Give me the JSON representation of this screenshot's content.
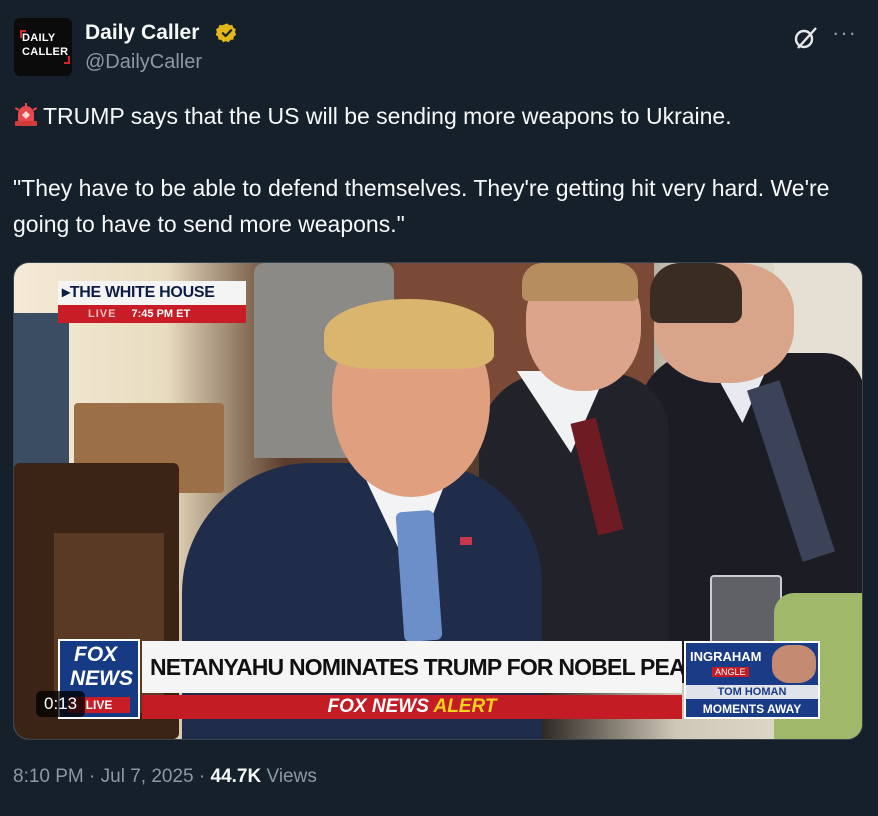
{
  "account": {
    "avatar_text_line1": "DAILY",
    "avatar_text_line2": "CALLER",
    "name": "Daily Caller",
    "handle": "@DailyCaller",
    "verified_icon": "gold-verified-badge-icon",
    "verified_color": "#e2b719"
  },
  "header_icons": [
    "grok-icon",
    "more-options-icon"
  ],
  "more_label": "···",
  "post": {
    "line1_emoji": "police-siren-icon",
    "line1": "TRUMP says that the US will be sending more weapons to Ukraine.",
    "line2": "\"They have to be able to defend themselves. They're getting hit very hard. We're going to have to send more weapons.\""
  },
  "video": {
    "location_badge": "THE WHITE HOUSE",
    "live_label": "LIVE",
    "time_label": "7:45 PM ET",
    "network_logo_line1": "FOX",
    "network_logo_line2": "NEWS",
    "network_logo_live": "LIVE",
    "headline": "NETANYAHU NOMINATES TRUMP FOR NOBEL PEACE PRIZE",
    "alert_prefix": "FOX NEWS",
    "alert_suffix": "ALERT",
    "promo_show": "INGRAHAM",
    "promo_show_sub": "ANGLE",
    "promo_guest": "TOM HOMAN",
    "promo_status": "MOMENTS AWAY",
    "elapsed": "0:13"
  },
  "footer": {
    "time": "8:10 PM",
    "separator": "·",
    "date": "Jul 7, 2025",
    "views_count": "44.7K",
    "views_label": "Views"
  },
  "colors": {
    "background": "#15202b",
    "text_primary": "#f7f9f9",
    "text_secondary": "#8b98a5",
    "fox_red": "#c31c24",
    "fox_blue": "#163a84"
  }
}
